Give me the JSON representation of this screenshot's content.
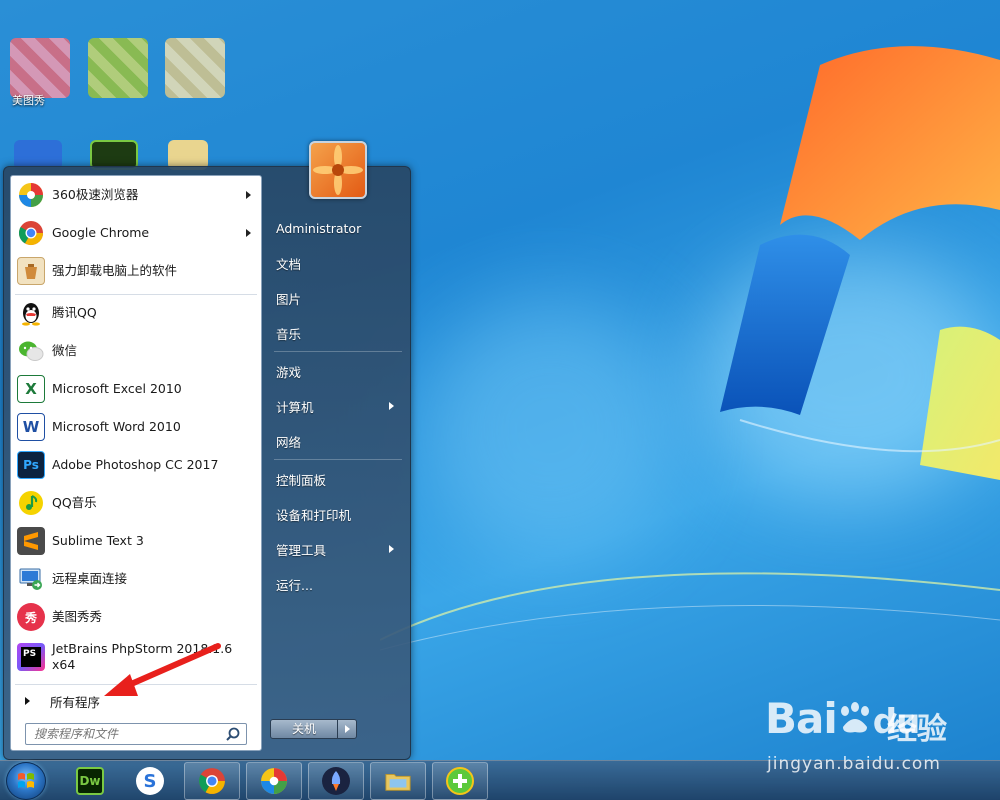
{
  "desktop": {
    "icons": [
      {
        "label": "美图秀"
      },
      {
        "label": ""
      },
      {
        "label": ""
      }
    ]
  },
  "start_menu": {
    "programs": [
      {
        "label": "360极速浏览器",
        "icon": "360-browser-icon",
        "has_submenu": true
      },
      {
        "label": "Google Chrome",
        "icon": "chrome-icon",
        "has_submenu": true
      },
      {
        "label": "强力卸载电脑上的软件",
        "icon": "uninstall-icon",
        "has_submenu": false
      },
      {
        "label": "腾讯QQ",
        "icon": "qq-icon",
        "has_submenu": false
      },
      {
        "label": "微信",
        "icon": "wechat-icon",
        "has_submenu": false
      },
      {
        "label": "Microsoft Excel 2010",
        "icon": "excel-icon",
        "has_submenu": false
      },
      {
        "label": "Microsoft Word 2010",
        "icon": "word-icon",
        "has_submenu": false
      },
      {
        "label": "Adobe Photoshop CC 2017",
        "icon": "photoshop-icon",
        "has_submenu": false
      },
      {
        "label": "QQ音乐",
        "icon": "qq-music-icon",
        "has_submenu": false
      },
      {
        "label": "Sublime Text 3",
        "icon": "sublime-icon",
        "has_submenu": false
      },
      {
        "label": "远程桌面连接",
        "icon": "remote-desktop-icon",
        "has_submenu": false
      },
      {
        "label": "美图秀秀",
        "icon": "meitu-icon",
        "has_submenu": false
      },
      {
        "label": "JetBrains PhpStorm 2018.1.6 x64",
        "label_line1": "JetBrains PhpStorm 2018.1.6",
        "label_line2": "x64",
        "icon": "phpstorm-icon",
        "has_submenu": false
      }
    ],
    "all_programs": "所有程序",
    "search_placeholder": "搜索程序和文件",
    "right_items": [
      {
        "label": "Administrator",
        "has_submenu": false
      },
      {
        "label": "文档",
        "has_submenu": false
      },
      {
        "label": "图片",
        "has_submenu": false
      },
      {
        "label": "音乐",
        "has_submenu": false
      },
      {
        "label": "游戏",
        "has_submenu": false
      },
      {
        "label": "计算机",
        "has_submenu": true
      },
      {
        "label": "网络",
        "has_submenu": false
      },
      {
        "label": "控制面板",
        "has_submenu": false
      },
      {
        "label": "设备和打印机",
        "has_submenu": false
      },
      {
        "label": "管理工具",
        "has_submenu": true
      },
      {
        "label": "运行...",
        "has_submenu": false
      }
    ],
    "shutdown_label": "关机"
  },
  "taskbar": {
    "items": [
      {
        "icon": "dreamweaver-icon",
        "text": "Dw"
      },
      {
        "icon": "sogou-icon",
        "text": "S"
      },
      {
        "icon": "chrome-icon",
        "text": ""
      },
      {
        "icon": "360-browser-icon",
        "text": ""
      },
      {
        "icon": "rocket-icon",
        "text": ""
      },
      {
        "icon": "file-explorer-icon",
        "text": ""
      },
      {
        "icon": "360-guard-icon",
        "text": ""
      }
    ]
  },
  "watermark": {
    "brand": "Bai",
    "brand_tail": "du",
    "cn": "经验",
    "url": "jingyan.baidu.com"
  },
  "colors": {
    "accent": "#1f86d3",
    "menu_dark": "#2d4c6e",
    "arrow_red": "#e8201c"
  }
}
